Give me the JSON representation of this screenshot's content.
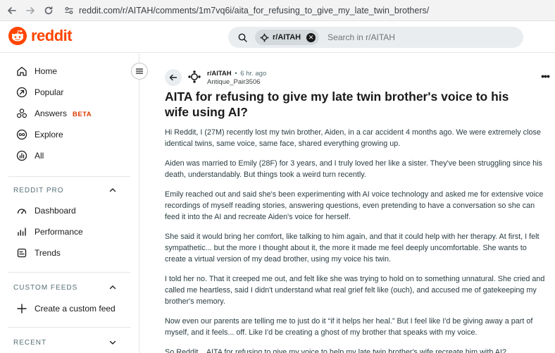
{
  "browser": {
    "url": "reddit.com/r/AITAH/comments/1m7vq6i/aita_for_refusing_to_give_my_late_twin_brothers/"
  },
  "header": {
    "logo_text": "reddit",
    "search_chip": "r/AITAH",
    "search_placeholder": "Search in r/AITAH"
  },
  "sidebar": {
    "main_items": [
      {
        "label": "Home",
        "icon": "home-icon"
      },
      {
        "label": "Popular",
        "icon": "popular-icon"
      },
      {
        "label": "Answers",
        "icon": "answers-icon",
        "badge": "BETA"
      },
      {
        "label": "Explore",
        "icon": "explore-icon"
      },
      {
        "label": "All",
        "icon": "all-icon"
      }
    ],
    "reddit_pro": {
      "title": "REDDIT PRO",
      "items": [
        {
          "label": "Dashboard",
          "icon": "dashboard-icon"
        },
        {
          "label": "Performance",
          "icon": "performance-icon"
        },
        {
          "label": "Trends",
          "icon": "trends-icon"
        }
      ]
    },
    "custom_feeds": {
      "title": "CUSTOM FEEDS",
      "create_label": "Create a custom feed"
    },
    "recent": {
      "title": "RECENT"
    }
  },
  "post": {
    "subreddit": "r/AITAH",
    "separator": "•",
    "time": "6 hr. ago",
    "author": "Antique_Pair3506",
    "more": "•••",
    "title": "AITA for refusing to give my late twin brother's voice to his wife using AI?",
    "paragraphs": [
      "Hi Reddit, I (27M) recently lost my twin brother, Aiden, in a car accident 4 months ago. We were extremely close identical twins, same voice, same face, shared everything growing up.",
      "Aiden was married to Emily (28F) for 3 years, and I truly loved her like a sister. They've been struggling since his death, understandably. But things took a weird turn recently.",
      "Emily reached out and said she's been experimenting with AI voice technology and asked me for extensive voice recordings of myself reading stories, answering questions, even pretending to have a conversation so she can feed it into the AI and recreate Aiden's voice for herself.",
      "She said it would bring her comfort, like talking to him again, and that it could help with her therapy. At first, I felt sympathetic... but the more I thought about it, the more it made me feel deeply uncomfortable. She wants to create a virtual version of my dead brother, using my voice his twin.",
      "I told her no. That it creeped me out, and felt like she was trying to hold on to something unnatural. She cried and called me heartless, said I didn't understand what real grief felt like (ouch), and accused me of gatekeeping my brother's memory.",
      "Now even our parents are telling me to just do it “if it helps her heal.” But I feel like I'd be giving away a part of myself, and it feels... off. Like I'd be creating a ghost of my brother that speaks with my voice.",
      "So Reddit... AITA for refusing to give my voice to help my late twin brother's wife recreate him with AI?"
    ]
  },
  "colors": {
    "brand": "#ff4500",
    "beta": "#d93a00",
    "text": "#1a1a1b",
    "muted": "#576f76",
    "search_bg": "#eaedef"
  }
}
